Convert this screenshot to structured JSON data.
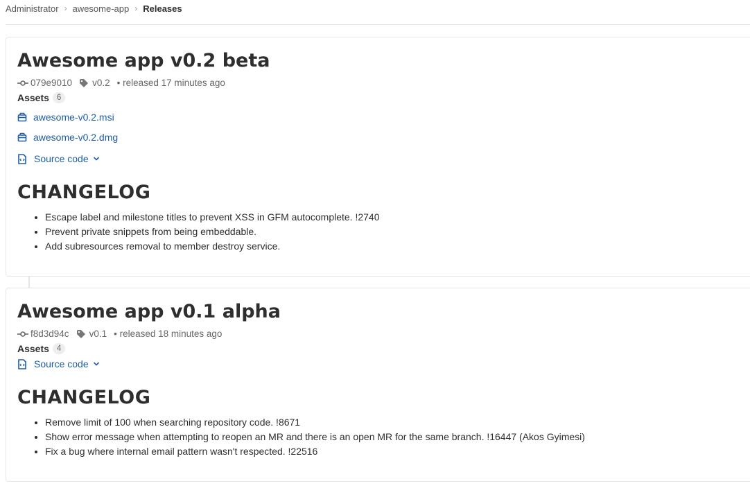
{
  "breadcrumb": {
    "items": [
      "Administrator",
      "awesome-app",
      "Releases"
    ]
  },
  "releases": [
    {
      "title": "Awesome app v0.2 beta",
      "commit": "079e9010",
      "tag": "v0.2",
      "released": "• released 17 minutes ago",
      "assets_label": "Assets",
      "assets_count": "6",
      "links": [
        "awesome-v0.2.msi",
        "awesome-v0.2.dmg"
      ],
      "source_code": "Source code",
      "changelog_heading": "CHANGELOG",
      "notes": [
        "Escape label and milestone titles to prevent XSS in GFM autocomplete. !2740",
        "Prevent private snippets from being embeddable.",
        "Add subresources removal to member destroy service."
      ]
    },
    {
      "title": "Awesome app v0.1 alpha",
      "commit": "f8d3d94c",
      "tag": "v0.1",
      "released": "• released 18 minutes ago",
      "assets_label": "Assets",
      "assets_count": "4",
      "links": [],
      "source_code": "Source code",
      "changelog_heading": "CHANGELOG",
      "notes": [
        "Remove limit of 100 when searching repository code. !8671",
        "Show error message when attempting to reopen an MR and there is an open MR for the same branch. !16447 (Akos Gyimesi)",
        "Fix a bug where internal email pattern wasn't respected. !22516"
      ]
    }
  ],
  "icons": {
    "commit": "commit-icon",
    "tag": "tag-icon",
    "package": "package-icon",
    "doc": "doc-code-icon",
    "chevron": "chevron-down-icon"
  },
  "colors": {
    "link": "#1f5ea5",
    "text": "#2e2e2e",
    "muted": "#666666",
    "border": "#e5e5e5"
  }
}
